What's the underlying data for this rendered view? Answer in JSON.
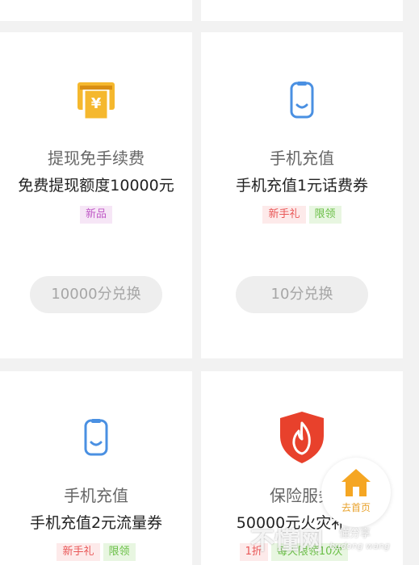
{
  "cards": [
    {
      "title": "",
      "subtitle": ""
    },
    {
      "title": "",
      "subtitle": ""
    },
    {
      "icon": "atm-yen-icon",
      "title": "提现免手续费",
      "subtitle": "免费提现额度10000元",
      "tags": [
        {
          "label": "新品",
          "color": "purple"
        }
      ],
      "button": "10000分兑换"
    },
    {
      "icon": "phone-icon",
      "title": "手机充值",
      "subtitle": "手机充值1元话费券",
      "tags": [
        {
          "label": "新手礼",
          "color": "pink"
        },
        {
          "label": "限领",
          "color": "green"
        }
      ],
      "button": "10分兑换"
    },
    {
      "icon": "phone-icon",
      "title": "手机充值",
      "subtitle": "手机充值2元流量券",
      "tags": [
        {
          "label": "新手礼",
          "color": "pink"
        },
        {
          "label": "限领",
          "color": "green"
        }
      ]
    },
    {
      "icon": "fire-shield-icon",
      "title": "保险服务",
      "subtitle": "50000元火灾补",
      "tags": [
        {
          "label": "1折",
          "color": "pink"
        },
        {
          "label": "每天限领10次",
          "color": "green"
        }
      ]
    }
  ],
  "home_button": {
    "label": "去首页",
    "icon": "house-icon"
  },
  "watermark": {
    "brand": "不懂网",
    "slogan": "懂分享",
    "pinyin": "budong wang"
  },
  "colors": {
    "accent": "#f5a623",
    "phone_icon": "#4a90e2",
    "shield": "#e8412c",
    "card_bg": "#ffffff",
    "page_bg": "#f2f2f2"
  }
}
